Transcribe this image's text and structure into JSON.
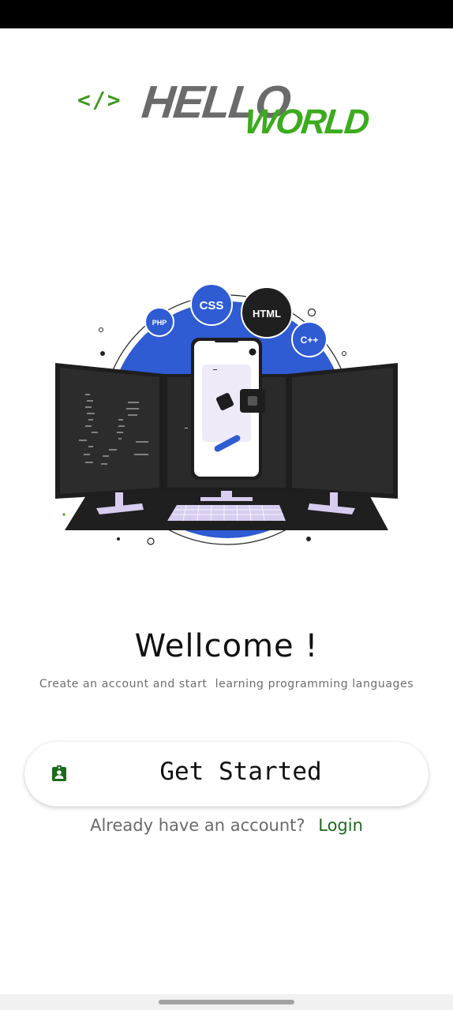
{
  "status_bar": {},
  "logo": {
    "brackets": "</>",
    "hello": "HELLO",
    "world": "WORLD"
  },
  "illustration": {
    "badges": [
      "CSS",
      "HTML",
      "PHP",
      "C++"
    ]
  },
  "welcome": {
    "title": "Wellcome !",
    "subtitle": "Create an account and start  learning programming languages"
  },
  "get_started": {
    "label": "Get Started",
    "icon": "assignment-ind-icon"
  },
  "login": {
    "prompt": "Already have an account?",
    "link": "Login"
  },
  "colors": {
    "brand_green": "#3cab1f",
    "link_green": "#1b6b1b",
    "illustration_blue": "#2f5bd3"
  }
}
